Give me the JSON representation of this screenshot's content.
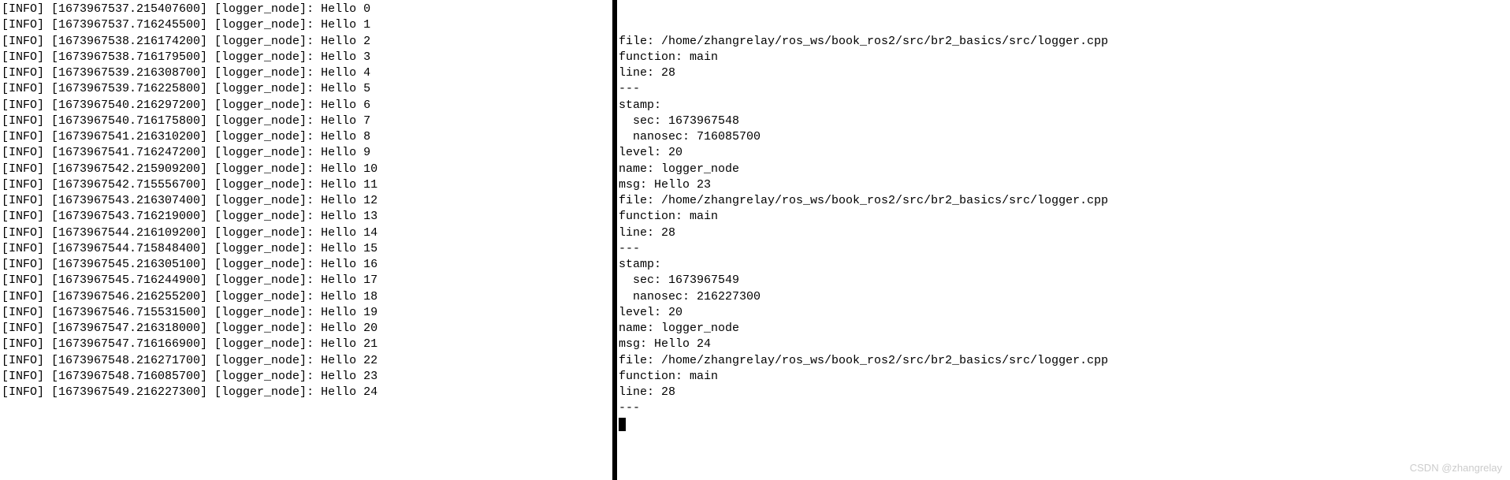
{
  "left": {
    "lines": [
      "[INFO] [1673967537.215407600] [logger_node]: Hello 0",
      "[INFO] [1673967537.716245500] [logger_node]: Hello 1",
      "[INFO] [1673967538.216174200] [logger_node]: Hello 2",
      "[INFO] [1673967538.716179500] [logger_node]: Hello 3",
      "[INFO] [1673967539.216308700] [logger_node]: Hello 4",
      "[INFO] [1673967539.716225800] [logger_node]: Hello 5",
      "[INFO] [1673967540.216297200] [logger_node]: Hello 6",
      "[INFO] [1673967540.716175800] [logger_node]: Hello 7",
      "[INFO] [1673967541.216310200] [logger_node]: Hello 8",
      "[INFO] [1673967541.716247200] [logger_node]: Hello 9",
      "[INFO] [1673967542.215909200] [logger_node]: Hello 10",
      "[INFO] [1673967542.715556700] [logger_node]: Hello 11",
      "[INFO] [1673967543.216307400] [logger_node]: Hello 12",
      "[INFO] [1673967543.716219000] [logger_node]: Hello 13",
      "[INFO] [1673967544.216109200] [logger_node]: Hello 14",
      "[INFO] [1673967544.715848400] [logger_node]: Hello 15",
      "[INFO] [1673967545.216305100] [logger_node]: Hello 16",
      "[INFO] [1673967545.716244900] [logger_node]: Hello 17",
      "[INFO] [1673967546.216255200] [logger_node]: Hello 18",
      "[INFO] [1673967546.715531500] [logger_node]: Hello 19",
      "[INFO] [1673967547.216318000] [logger_node]: Hello 20",
      "[INFO] [1673967547.716166900] [logger_node]: Hello 21",
      "[INFO] [1673967548.216271700] [logger_node]: Hello 22",
      "[INFO] [1673967548.716085700] [logger_node]: Hello 23",
      "[INFO] [1673967549.216227300] [logger_node]: Hello 24"
    ]
  },
  "right": {
    "lines": [
      "file: /home/zhangrelay/ros_ws/book_ros2/src/br2_basics/src/logger.cpp",
      "function: main",
      "line: 28",
      "---",
      "stamp:",
      "  sec: 1673967548",
      "  nanosec: 716085700",
      "level: 20",
      "name: logger_node",
      "msg: Hello 23",
      "file: /home/zhangrelay/ros_ws/book_ros2/src/br2_basics/src/logger.cpp",
      "function: main",
      "line: 28",
      "---",
      "stamp:",
      "  sec: 1673967549",
      "  nanosec: 216227300",
      "level: 20",
      "name: logger_node",
      "msg: Hello 24",
      "file: /home/zhangrelay/ros_ws/book_ros2/src/br2_basics/src/logger.cpp",
      "function: main",
      "line: 28",
      "---"
    ]
  },
  "watermark": "CSDN @zhangrelay"
}
